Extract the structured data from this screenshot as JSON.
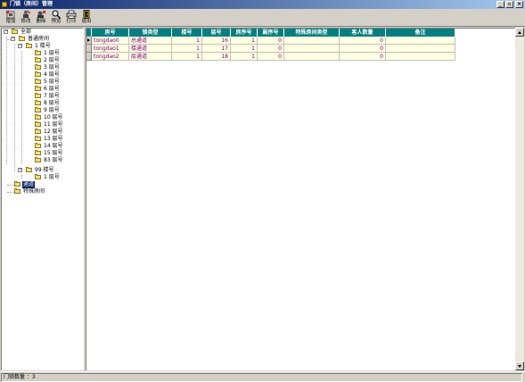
{
  "window": {
    "title": "门锁（房间）管理",
    "controls": [
      "_",
      "▫",
      "×"
    ]
  },
  "toolbar": {
    "buttons": [
      {
        "label": "增加",
        "icon": "add-icon"
      },
      {
        "label": "修改",
        "icon": "edit-icon"
      },
      {
        "label": "删除",
        "icon": "delete-icon"
      },
      {
        "label": "预览",
        "icon": "preview-icon"
      },
      {
        "label": "打印",
        "icon": "print-icon"
      },
      {
        "label": "退出",
        "icon": "exit-icon"
      }
    ]
  },
  "tree": {
    "root": "全部",
    "group_normal": "普通房间",
    "building1": "1 楼号",
    "floors": [
      "1 层号",
      "2 层号",
      "3 层号",
      "4 层号",
      "5 层号",
      "6 层号",
      "7 层号",
      "8 层号",
      "9 层号",
      "10 层号",
      "11 层号",
      "12 层号",
      "13 层号",
      "14 层号",
      "15 层号",
      "83 层号"
    ],
    "building99": "99 楼号",
    "building99_floor": "1 层号",
    "channel": "通道",
    "group_special": "特殊房间"
  },
  "grid": {
    "columns": [
      "房号",
      "锁类型",
      "楼号",
      "层号",
      "房序号",
      "副序号",
      "特殊房间类型",
      "客人数量",
      "备注"
    ],
    "rows": [
      [
        "tongdao0",
        "总通道",
        "1",
        "16",
        "1",
        "0",
        "",
        "0",
        ""
      ],
      [
        "tongdao1",
        "楼通道",
        "1",
        "17",
        "1",
        "0",
        "",
        "0",
        ""
      ],
      [
        "tongdao2",
        "层通道",
        "1",
        "18",
        "1",
        "0",
        "",
        "0",
        ""
      ]
    ]
  },
  "status": {
    "text": "门锁数量 ：3"
  },
  "colors": {
    "header_bg": "#008080",
    "row_bg": "#ffffe1",
    "lock_type_text": "#800080",
    "selection": "#0a246a"
  }
}
